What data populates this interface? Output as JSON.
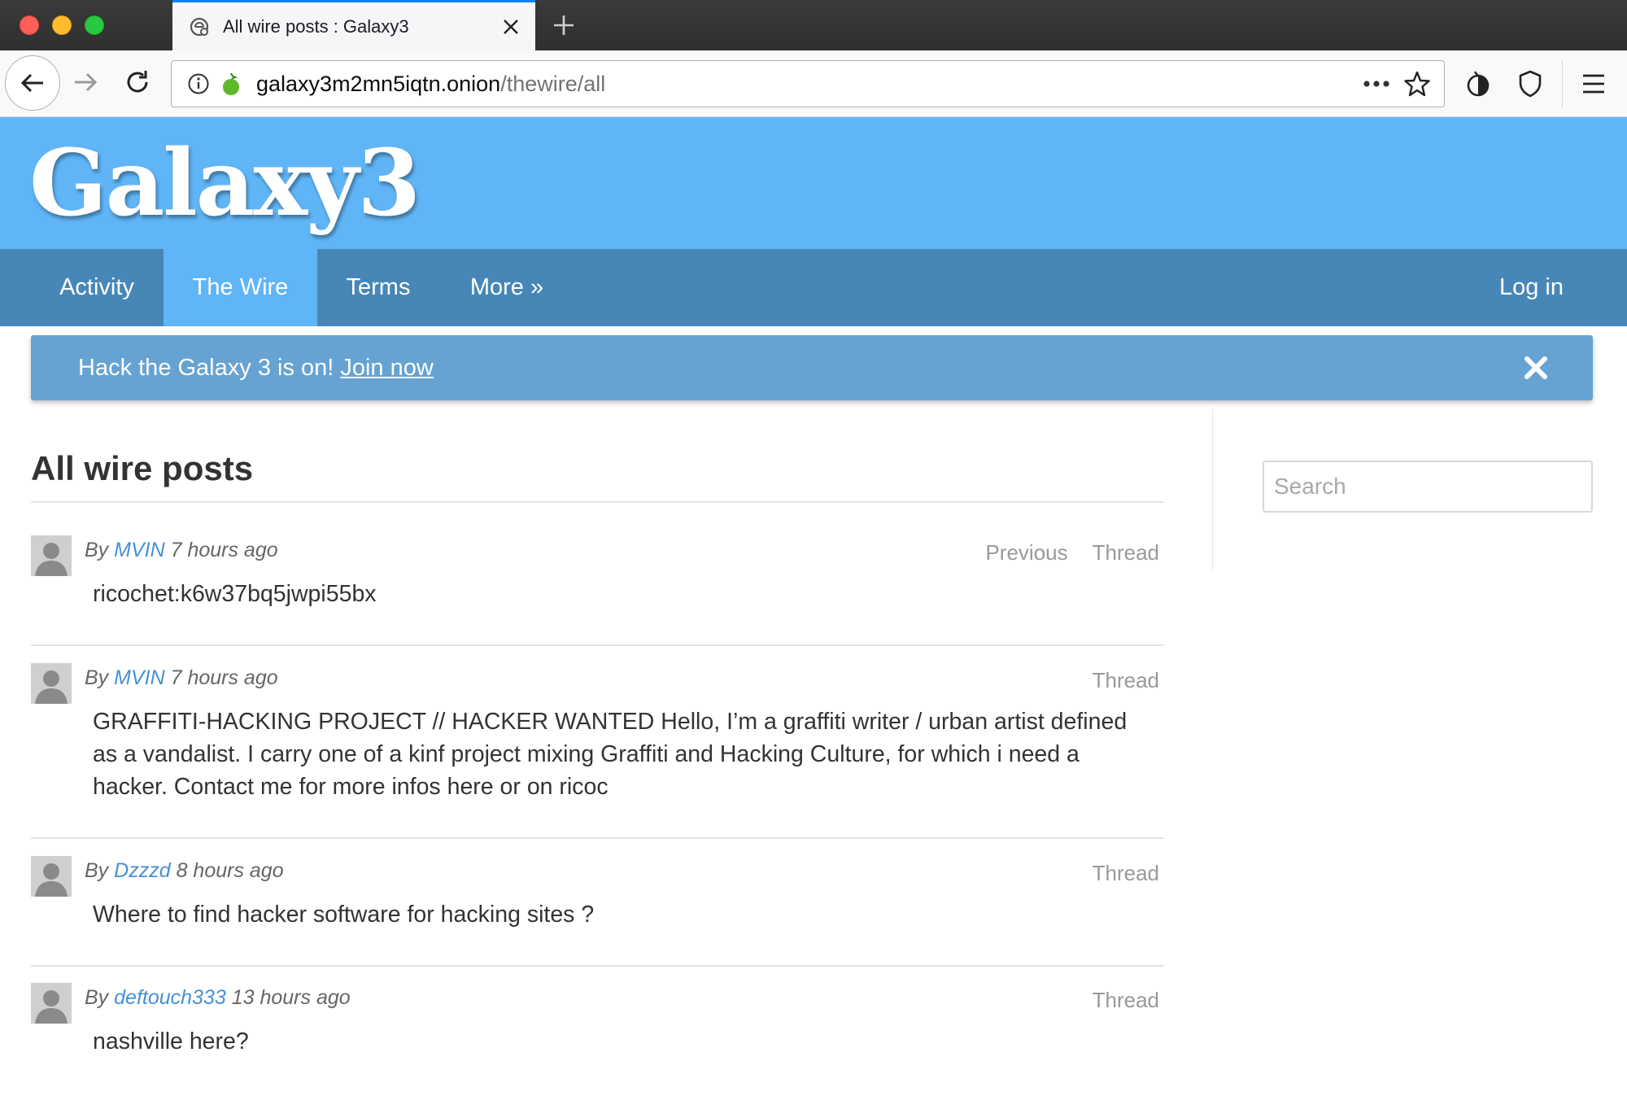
{
  "browser": {
    "tab_title": "All wire posts : Galaxy3",
    "url_host": "galaxy3m2mn5iqtn.onion",
    "url_path": "/thewire/all"
  },
  "site": {
    "logo": "Galaxy3",
    "nav": {
      "activity": "Activity",
      "the_wire": "The Wire",
      "terms": "Terms",
      "more": "More »",
      "login": "Log in"
    },
    "banner": {
      "text": "Hack the Galaxy 3 is on!",
      "link": "Join now"
    },
    "search_placeholder": "Search",
    "page_title": "All wire posts"
  },
  "posts": [
    {
      "by": "By",
      "user": "MVIN",
      "time": "7 hours ago",
      "previous": "Previous",
      "thread": "Thread",
      "body": "ricochet:k6w37bq5jwpi55bx"
    },
    {
      "by": "By",
      "user": "MVIN",
      "time": "7 hours ago",
      "thread": "Thread",
      "body": "GRAFFITI-HACKING PROJECT // HACKER WANTED Hello, I’m a graffiti writer / urban artist defined as a vandalist. I carry one of a kinf project mixing Graffiti and Hacking Culture, for which i need a hacker. Contact me for more infos here or on ricoc"
    },
    {
      "by": "By",
      "user": "Dzzzd",
      "time": "8 hours ago",
      "thread": "Thread",
      "body": "Where to find hacker software for hacking sites ?"
    },
    {
      "by": "By",
      "user": "deftouch333",
      "time": "13 hours ago",
      "thread": "Thread",
      "body": "nashville here?"
    }
  ],
  "colors": {
    "header_bg": "#60b5f6",
    "nav_bg": "#4787b8",
    "banner_bg": "#66a3d3",
    "link": "#4690d6"
  }
}
